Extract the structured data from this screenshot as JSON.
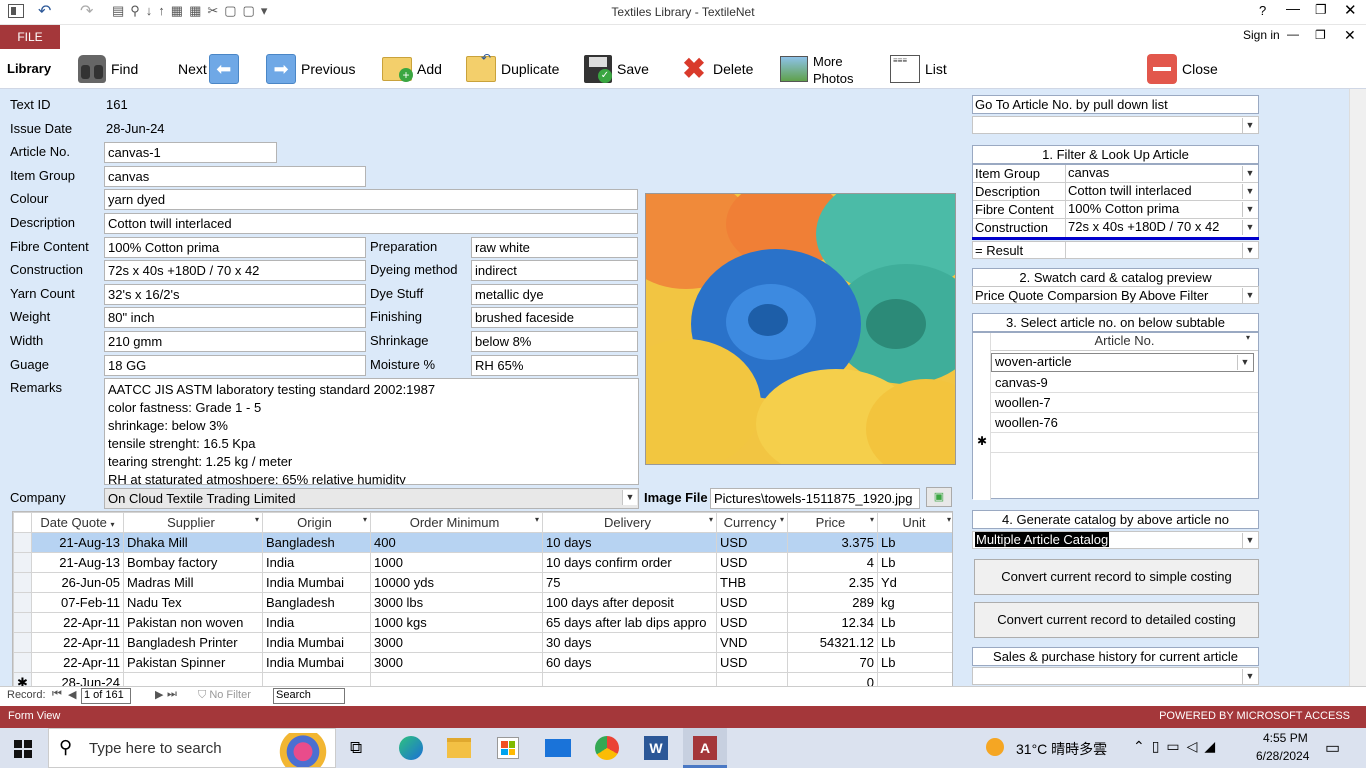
{
  "window": {
    "title": "Textiles Library - TextileNet",
    "help": "?",
    "signin": "Sign in"
  },
  "ribbon": {
    "file": "FILE",
    "group": "Library",
    "find": "Find",
    "next": "Next",
    "previous": "Previous",
    "add": "Add",
    "duplicate": "Duplicate",
    "save": "Save",
    "delete": "Delete",
    "more_photos_1": "More",
    "more_photos_2": "Photos",
    "list": "List",
    "close": "Close"
  },
  "record": {
    "text_id_label": "Text ID",
    "text_id": "161",
    "issue_date_label": "Issue Date",
    "issue_date": "28-Jun-24",
    "article_no_label": "Article No.",
    "article_no": "canvas-1",
    "item_group_label": "Item Group",
    "item_group": "canvas",
    "colour_label": "Colour",
    "colour": "yarn dyed",
    "description_label": "Description",
    "description": "Cotton twill interlaced",
    "fibre_label": "Fibre Content",
    "fibre": "100% Cotton prima",
    "construction_label": "Construction",
    "construction": "72s x 40s +180D / 70 x 42",
    "yarn_label": "Yarn Count",
    "yarn": "32's x 16/2's",
    "weight_label": "Weight",
    "weight": "80\" inch",
    "width_label": "Width",
    "width": "210 gmm",
    "guage_label": "Guage",
    "guage": "18 GG",
    "preparation_label": "Preparation",
    "preparation": "raw white",
    "dyeing_label": "Dyeing method",
    "dyeing": "indirect",
    "dyestuff_label": "Dye Stuff",
    "dyestuff": "metallic dye",
    "finishing_label": "Finishing",
    "finishing": "brushed faceside",
    "shrinkage_label": "Shrinkage",
    "shrinkage": "below 8%",
    "moisture_label": "Moisture %",
    "moisture": "RH 65%",
    "remarks_label": "Remarks",
    "remarks": [
      "AATCC JIS ASTM laboratory testing standard   2002:1987",
      "color fastness: Grade 1 - 5",
      "shrinkage: below 3%",
      "tensile strenght: 16.5 Kpa",
      "tearing strenght: 1.25 kg / meter",
      "RH at staturated atmoshpere: 65% relative humidity"
    ],
    "company_label": "Company",
    "company": "On Cloud Textile Trading Limited",
    "image_label": "Image File",
    "image_file": "Pictures\\towels-1511875_1920.jpg"
  },
  "quotes": {
    "headers": [
      "Date Quote",
      "Supplier",
      "Origin",
      "Order Minimum",
      "Delivery",
      "Currency",
      "Price",
      "Unit"
    ],
    "rows": [
      [
        "21-Aug-13",
        "Dhaka Mill",
        "Bangladesh",
        "400",
        "10 days",
        "USD",
        "3.375",
        "Lb"
      ],
      [
        "21-Aug-13",
        "Bombay factory",
        "India",
        "1000",
        "10 days confirm order",
        "USD",
        "4",
        "Lb"
      ],
      [
        "26-Jun-05",
        "Madras Mill",
        "India Mumbai",
        "10000 yds",
        "75",
        "THB",
        "2.35",
        "Yd"
      ],
      [
        "07-Feb-11",
        "Nadu Tex",
        "Bangladesh",
        "3000 lbs",
        "100 days after deposit",
        "USD",
        "289",
        "kg"
      ],
      [
        "22-Apr-11",
        "Pakistan non woven",
        "India",
        "1000 kgs",
        "65 days after lab dips appro",
        "USD",
        "12.34",
        "Lb"
      ],
      [
        "22-Apr-11",
        "Bangladesh Printer",
        "India Mumbai",
        "3000",
        "30 days",
        "VND",
        "54321.12",
        "Lb"
      ],
      [
        "22-Apr-11",
        "Pakistan Spinner",
        "India Mumbai",
        "3000",
        "60 days",
        "USD",
        "70",
        "Lb"
      ],
      [
        "28-Jun-24",
        "",
        "",
        "",
        "",
        "",
        "0",
        ""
      ]
    ]
  },
  "side": {
    "goto_title": "Go To Article No. by pull down list",
    "filter_title": "1. Filter & Look Up Article",
    "filter_rows": [
      {
        "label": "Item Group",
        "value": "canvas"
      },
      {
        "label": "Description",
        "value": "Cotton twill interlaced"
      },
      {
        "label": "Fibre Content",
        "value": "100% Cotton prima"
      },
      {
        "label": "Construction",
        "value": "72s x 40s +180D / 70 x 42"
      }
    ],
    "result_label": "= Result",
    "swatch_title": "2. Swatch card & catalog preview",
    "swatch_value": "Price Quote Comparsion By Above Filter",
    "select_title": "3. Select article no.  on below subtable",
    "select_header": "Article No.",
    "select_items": [
      "woven-article",
      "canvas-9",
      "woollen-7",
      "woollen-76"
    ],
    "generate_title": "4. Generate catalog by above article no",
    "generate_value": "Multiple Article Catalog",
    "simple_btn": "Convert current record to simple costing",
    "detailed_btn": "Convert current record to detailed costing",
    "history_title": "Sales & purchase history for current article"
  },
  "nav": {
    "record_label": "Record:",
    "record_pos": "1 of 161",
    "no_filter": "No Filter",
    "search": "Search"
  },
  "status": {
    "left": "Form View",
    "right": "POWERED BY MICROSOFT ACCESS"
  },
  "taskbar": {
    "search": "Type here to search",
    "weather": "31°C  晴時多雲",
    "time": "4:55 PM",
    "date": "6/28/2024"
  },
  "colors": {
    "accent": "#a4373a",
    "form_bg": "#dbe9f9",
    "selected_row": "#b7d3f2",
    "filter_line": "#0000cc"
  }
}
